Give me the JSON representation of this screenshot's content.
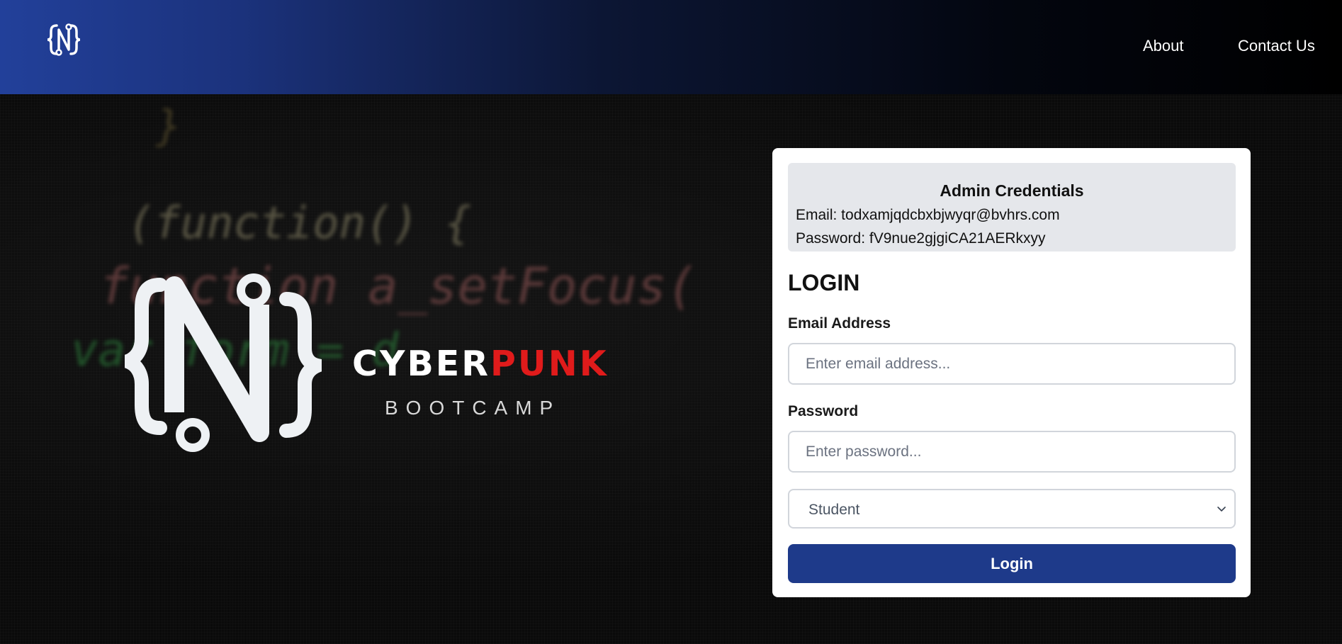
{
  "header": {
    "logo_icon": "curly-brace-n-logo-icon",
    "nav": {
      "about": "About",
      "contact": "Contact Us"
    }
  },
  "hero": {
    "background_code": [
      "}",
      "(function() {",
      "function a_setFocus(",
      "var form = d"
    ],
    "brand": {
      "name_part1": "CYBER",
      "name_part2": "PUNK",
      "subtitle": "BOOTCAMP",
      "accent_color": "#e01b1b"
    }
  },
  "login": {
    "credentials": {
      "title": "Admin Credentials",
      "email_line": "Email: todxamjqdcbxbjwyqr@bvhrs.com",
      "password_line": "Password: fV9nue2gjgiCA21AERkxyy"
    },
    "title": "LOGIN",
    "email_label": "Email Address",
    "email_placeholder": "Enter email address...",
    "password_label": "Password",
    "password_placeholder": "Enter password...",
    "role_selected": "Student",
    "submit_label": "Login",
    "button_color": "#1e3a8a"
  }
}
